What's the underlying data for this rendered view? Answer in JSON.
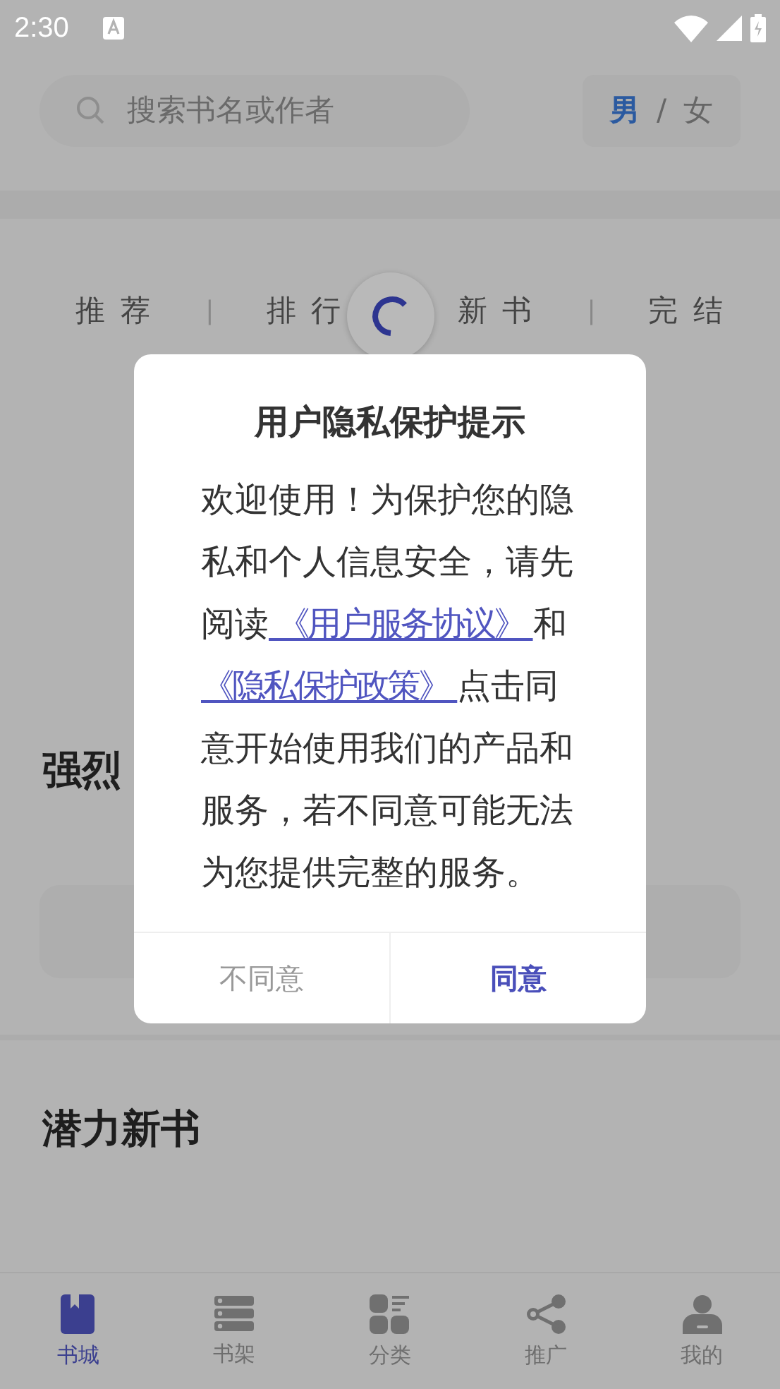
{
  "status_bar": {
    "time": "2:30"
  },
  "search": {
    "placeholder": "搜索书名或作者"
  },
  "gender": [
    {
      "label": "男",
      "selected": true
    },
    {
      "label": "女",
      "selected": false
    }
  ],
  "gender_separator": "/",
  "tabs": [
    {
      "label": "推 荐"
    },
    {
      "label": "排 行"
    },
    {
      "label": "新 书"
    },
    {
      "label": "完 结"
    }
  ],
  "tab_separator": "|",
  "loading": true,
  "sections": [
    {
      "title": "强烈"
    },
    {
      "title": "潜力新书"
    }
  ],
  "dialog": {
    "title": "用户隐私保护提示",
    "body": [
      {
        "kind": "text",
        "text": "欢迎使用！为保护您的隐私和个人信息安全，请先阅读"
      },
      {
        "kind": "link",
        "text": " 《用户服务协议》 "
      },
      {
        "kind": "text",
        "text": "和"
      },
      {
        "kind": "link",
        "text": " 《隐私保护政策》 "
      },
      {
        "kind": "text",
        "text": "点击同意开始使用我们的产品和服务，若不同意可能无法为您提供完整的服务。"
      }
    ],
    "buttons": [
      {
        "label": "不同意",
        "primary": false
      },
      {
        "label": "同意",
        "primary": true
      }
    ]
  },
  "nav": [
    {
      "label": "书城",
      "kind": "book",
      "selected": true
    },
    {
      "label": "书架",
      "kind": "shelf",
      "selected": false
    },
    {
      "label": "分类",
      "kind": "category",
      "selected": false
    },
    {
      "label": "推广",
      "kind": "share",
      "selected": false
    },
    {
      "label": "我的",
      "kind": "user",
      "selected": false
    }
  ]
}
